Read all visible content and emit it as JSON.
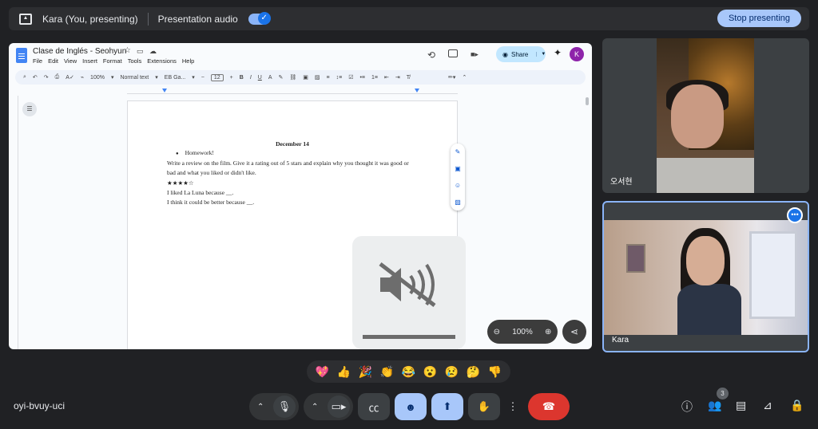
{
  "presenting_bar": {
    "presenter": "Kara (You, presenting)",
    "audio_label": "Presentation audio",
    "audio_on": true,
    "stop_label": "Stop presenting"
  },
  "doc": {
    "title": "Clase de Inglés - Seohyun",
    "menu": [
      "File",
      "Edit",
      "View",
      "Insert",
      "Format",
      "Tools",
      "Extensions",
      "Help"
    ],
    "share_label": "Share",
    "avatar_letter": "K",
    "toolbar": {
      "zoom": "100%",
      "style": "Normal text",
      "font": "EB Ga...",
      "font_size": "12"
    },
    "content": {
      "date": "December 14",
      "bullet": "Homework!",
      "lines": [
        "Write a review on the film. Give it a rating out of 5 stars and explain why you thought it was good or bad and what you liked or didn't like.",
        "★★★★☆",
        "I liked La Luna because __.",
        "I think it could be better because __."
      ]
    },
    "zoom_overlay": "100%"
  },
  "participants": [
    {
      "name": "오서현"
    },
    {
      "name": "Kara"
    }
  ],
  "reactions": [
    "💖",
    "👍",
    "🎉",
    "👏",
    "😂",
    "😮",
    "😢",
    "🤔",
    "👎"
  ],
  "meeting": {
    "code": "oyi-bvuy-uci",
    "participant_count": "3"
  },
  "colors": {
    "background": "#202124",
    "accent": "#a8c7fa",
    "end_call": "#dc362e",
    "active_border": "#8ab4f8"
  }
}
